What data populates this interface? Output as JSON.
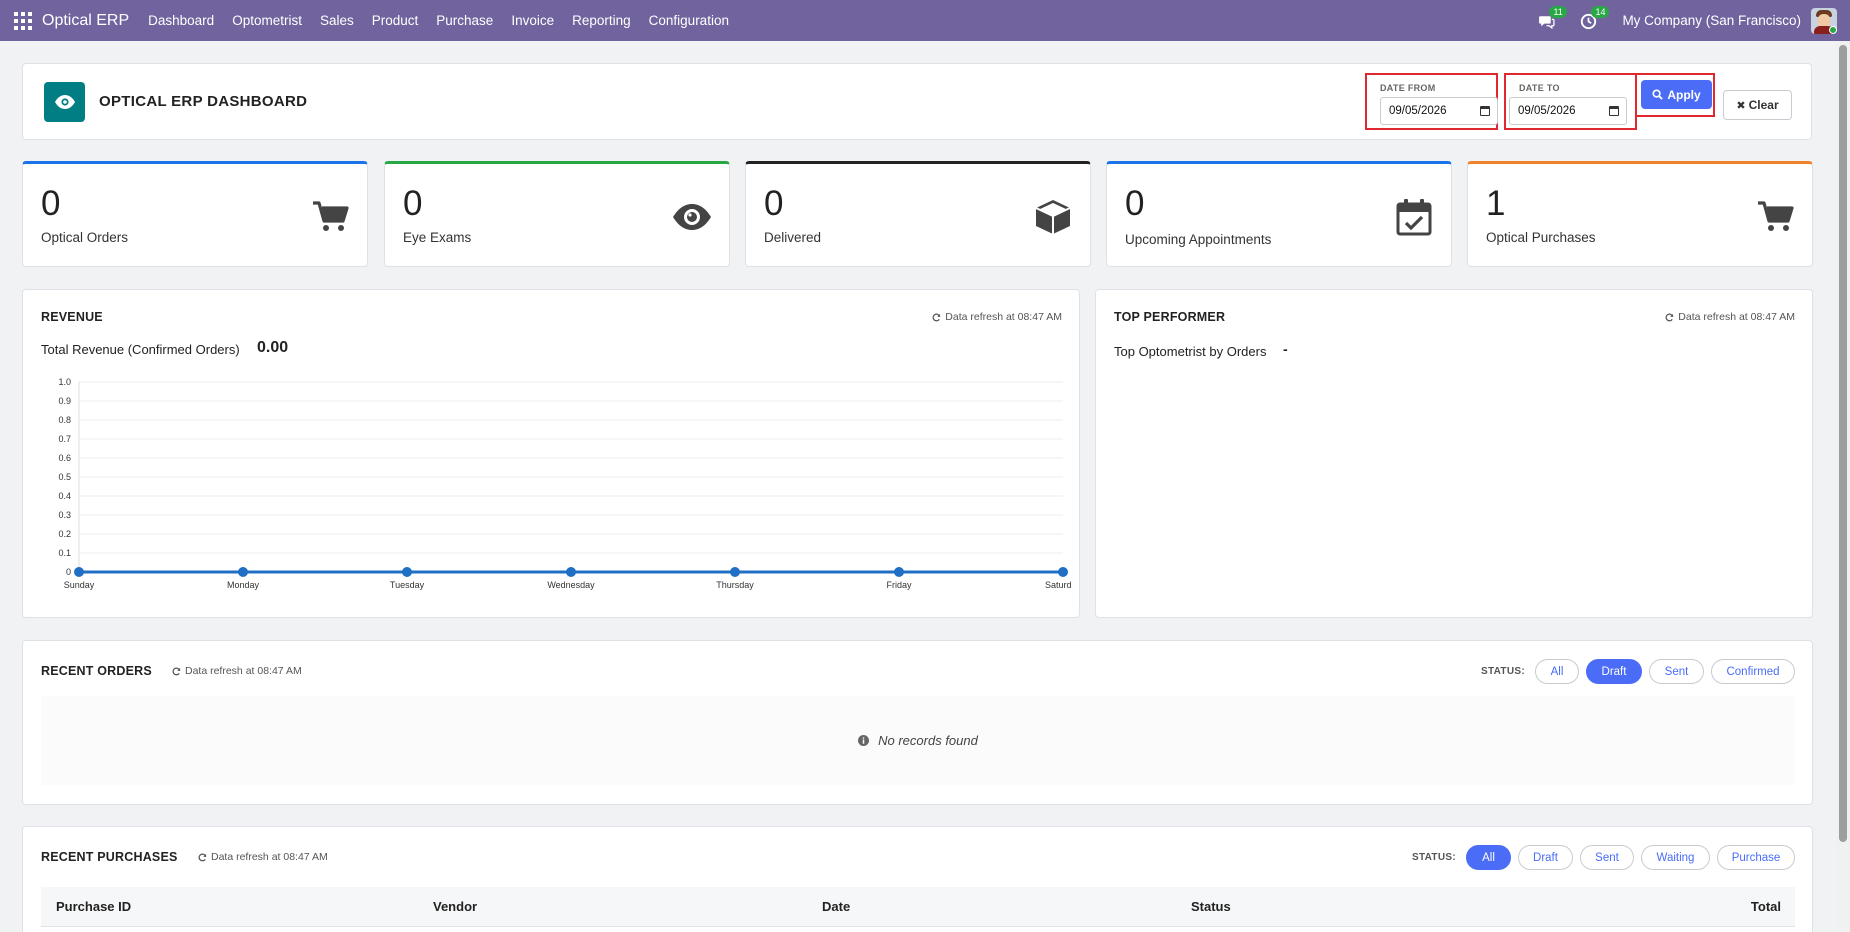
{
  "navbar": {
    "brand": "Optical ERP",
    "menu": [
      "Dashboard",
      "Optometrist",
      "Sales",
      "Product",
      "Purchase",
      "Invoice",
      "Reporting",
      "Configuration"
    ],
    "messages_badge": "11",
    "activities_badge": "14",
    "company": "My Company (San Francisco)"
  },
  "header": {
    "title": "OPTICAL ERP DASHBOARD",
    "date_from_label": "DATE FROM",
    "date_from_value": "09/05/2026",
    "date_to_label": "DATE TO",
    "date_to_value": "09/05/2026",
    "apply_label": "Apply",
    "clear_label": "Clear"
  },
  "kpis": [
    {
      "value": "0",
      "label": "Optical Orders",
      "color": "#1a73e8",
      "icon": "cart-icon"
    },
    {
      "value": "0",
      "label": "Eye Exams",
      "color": "#28a745",
      "icon": "eye-icon"
    },
    {
      "value": "0",
      "label": "Delivered",
      "color": "#222222",
      "icon": "box-icon"
    },
    {
      "value": "0",
      "label": "Upcoming Appointments",
      "color": "#1a73e8",
      "icon": "calendar-check-icon"
    },
    {
      "value": "1",
      "label": "Optical Purchases",
      "color": "#f0822b",
      "icon": "cart-icon"
    }
  ],
  "revenue": {
    "title": "REVENUE",
    "refresh": "Data refresh at 08:47 AM",
    "metric_label": "Total Revenue (Confirmed Orders)",
    "metric_value": "0.00"
  },
  "top_performer": {
    "title": "TOP PERFORMER",
    "refresh": "Data refresh at 08:47 AM",
    "metric_label": "Top Optometrist by Orders",
    "metric_value": "-"
  },
  "chart_data": {
    "type": "line",
    "categories": [
      "Sunday",
      "Monday",
      "Tuesday",
      "Wednesday",
      "Thursday",
      "Friday",
      "Saturday"
    ],
    "series": [
      {
        "values": [
          0,
          0,
          0,
          0,
          0,
          0,
          0
        ]
      }
    ],
    "yticks": [
      "0",
      "0.1",
      "0.2",
      "0.3",
      "0.4",
      "0.5",
      "0.6",
      "0.7",
      "0.8",
      "0.9",
      "1.0"
    ],
    "ylim": [
      0,
      1
    ],
    "grid": true,
    "line_color": "#1f6fc5"
  },
  "recent_orders": {
    "title": "RECENT ORDERS",
    "refresh": "Data refresh at 08:47 AM",
    "status_label": "STATUS:",
    "filters": [
      "All",
      "Draft",
      "Sent",
      "Confirmed"
    ],
    "active_filter": "Draft",
    "empty_message": "No records found"
  },
  "recent_purchases": {
    "title": "RECENT PURCHASES",
    "refresh": "Data refresh at 08:47 AM",
    "status_label": "STATUS:",
    "filters": [
      "All",
      "Draft",
      "Sent",
      "Waiting",
      "Purchase"
    ],
    "active_filter": "All",
    "columns": [
      "Purchase ID",
      "Vendor",
      "Date",
      "Status",
      "Total"
    ]
  }
}
